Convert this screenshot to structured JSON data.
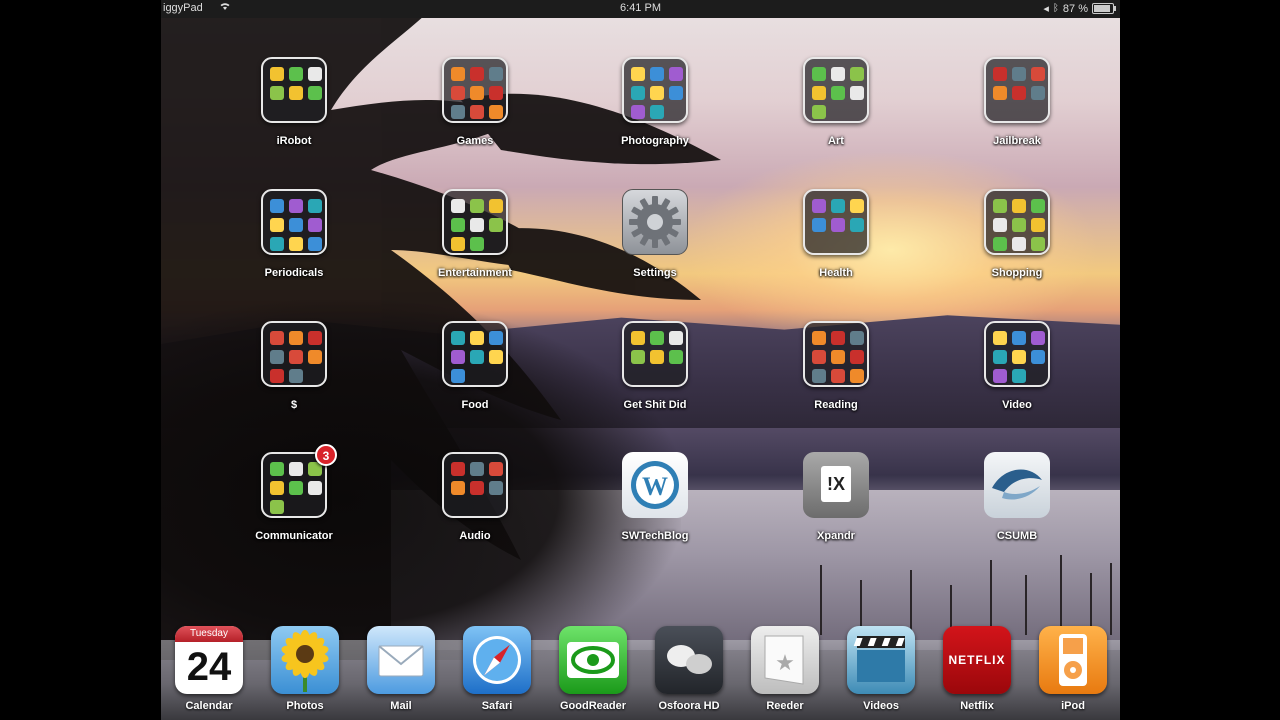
{
  "statusbar": {
    "carrier": "iggyPad",
    "time": "6:41 PM",
    "battery": "87 %",
    "battery_level": 0.87
  },
  "colors": {
    "badge": "#d8232a",
    "statusbar": "#1c1c1c"
  },
  "home": {
    "icons": [
      {
        "id": "irobot",
        "label": "iRobot",
        "type": "folder"
      },
      {
        "id": "games",
        "label": "Games",
        "type": "folder"
      },
      {
        "id": "photography",
        "label": "Photography",
        "type": "folder"
      },
      {
        "id": "art",
        "label": "Art",
        "type": "folder"
      },
      {
        "id": "jailbreak",
        "label": "Jailbreak",
        "type": "folder"
      },
      {
        "id": "periodicals",
        "label": "Periodicals",
        "type": "folder"
      },
      {
        "id": "entertainment",
        "label": "Entertainment",
        "type": "folder"
      },
      {
        "id": "settings",
        "label": "Settings",
        "type": "app",
        "icon": "gear-icon"
      },
      {
        "id": "health",
        "label": "Health",
        "type": "folder"
      },
      {
        "id": "shopping",
        "label": "Shopping",
        "type": "folder"
      },
      {
        "id": "dollar",
        "label": "$",
        "type": "folder"
      },
      {
        "id": "food",
        "label": "Food",
        "type": "folder"
      },
      {
        "id": "get-shit-did",
        "label": "Get Shit Did",
        "type": "folder"
      },
      {
        "id": "reading",
        "label": "Reading",
        "type": "folder"
      },
      {
        "id": "video",
        "label": "Video",
        "type": "folder"
      },
      {
        "id": "communicator",
        "label": "Communicator",
        "type": "folder",
        "badge": "3"
      },
      {
        "id": "audio",
        "label": "Audio",
        "type": "folder"
      },
      {
        "id": "swtechblog",
        "label": "SWTechBlog",
        "type": "app",
        "icon": "wordpress-icon"
      },
      {
        "id": "xpandr",
        "label": "Xpandr",
        "type": "app",
        "icon": "xpandr-icon",
        "glyph": "!X"
      },
      {
        "id": "csumb",
        "label": "CSUMB",
        "type": "app",
        "icon": "csumb-logo-icon"
      }
    ]
  },
  "dock": {
    "apps": [
      {
        "id": "calendar",
        "label": "Calendar",
        "day_name": "Tuesday",
        "day_number": "24"
      },
      {
        "id": "photos",
        "label": "Photos"
      },
      {
        "id": "mail",
        "label": "Mail"
      },
      {
        "id": "safari",
        "label": "Safari"
      },
      {
        "id": "goodreader",
        "label": "GoodReader"
      },
      {
        "id": "osfoora",
        "label": "Osfoora HD"
      },
      {
        "id": "reeder",
        "label": "Reeder"
      },
      {
        "id": "videos",
        "label": "Videos"
      },
      {
        "id": "netflix",
        "label": "Netflix",
        "logo_text": "NETFLIX"
      },
      {
        "id": "ipod",
        "label": "iPod"
      }
    ]
  }
}
